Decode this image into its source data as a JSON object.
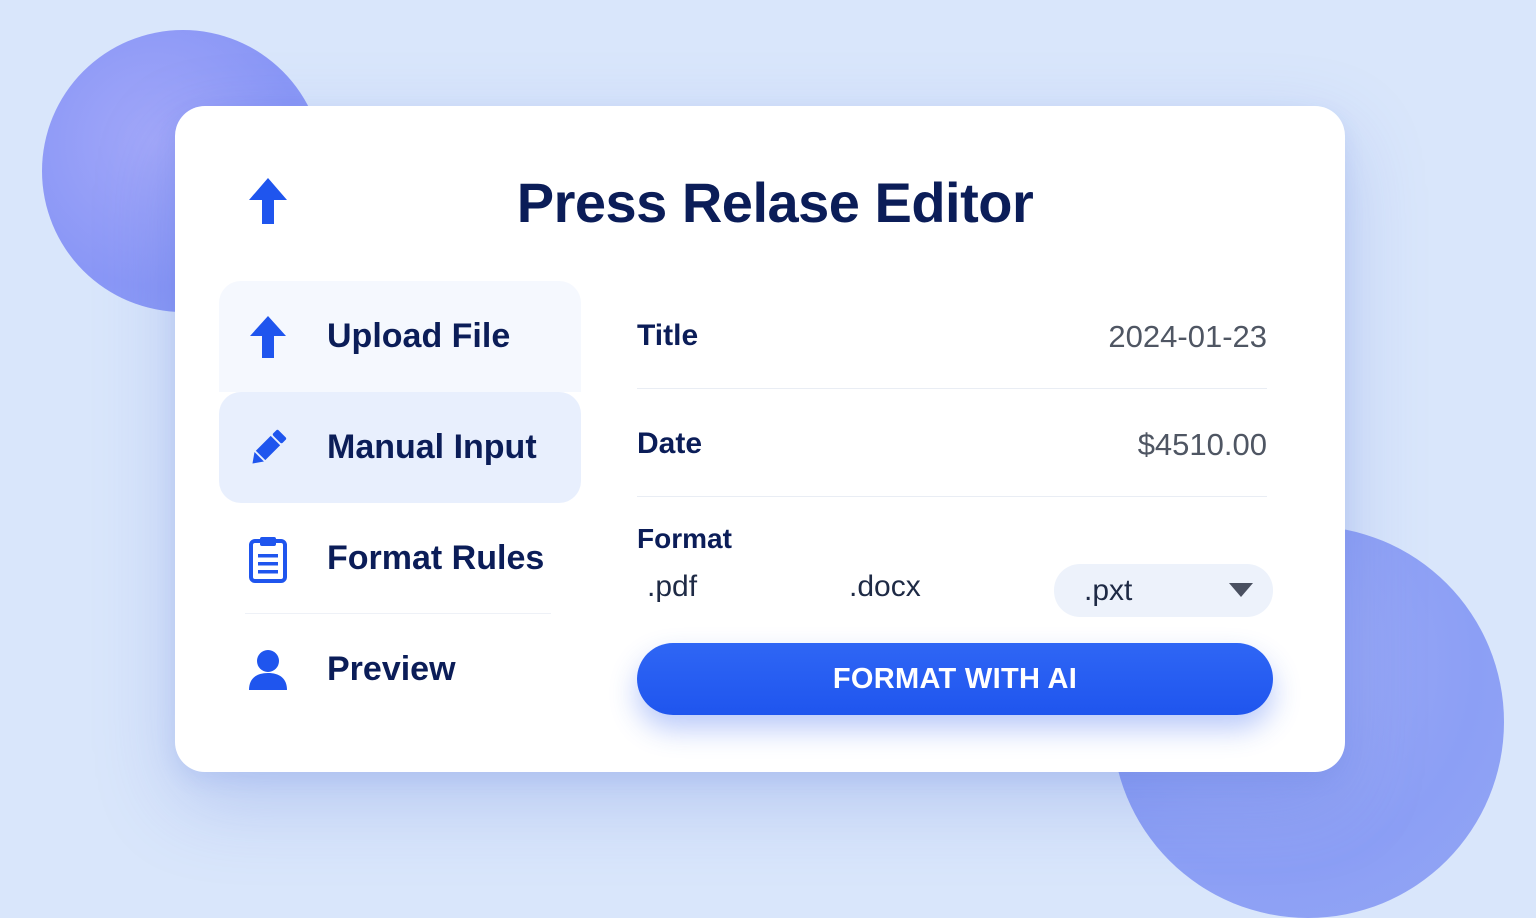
{
  "app": {
    "title": "Press Relase Editor"
  },
  "sidebar": {
    "items": [
      {
        "label": "Upload File",
        "icon": "upload-arrow-icon"
      },
      {
        "label": "Manual Input",
        "icon": "pencil-icon",
        "active": true
      },
      {
        "label": "Format Rules",
        "icon": "clipboard-icon"
      },
      {
        "label": "Preview",
        "icon": "user-icon"
      }
    ]
  },
  "form": {
    "fields": [
      {
        "label": "Title",
        "value": "2024-01-23"
      },
      {
        "label": "Date",
        "value": "$4510.00"
      }
    ],
    "format": {
      "label": "Format",
      "options": [
        ".pdf",
        ".docx"
      ],
      "selected": ".pxt"
    },
    "submit_label": "FORMAT WITH AI"
  },
  "colors": {
    "accent": "#2f66f5",
    "title": "#0b1d58",
    "background": "#d9e6fb",
    "active_item": "#e8effd"
  }
}
